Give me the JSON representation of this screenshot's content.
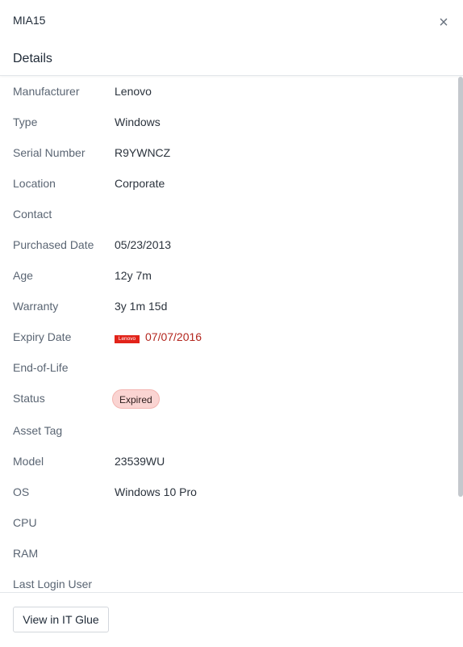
{
  "header": {
    "asset_name": "MIA15",
    "close_glyph": "×",
    "section_title": "Details"
  },
  "details": [
    {
      "label": "Manufacturer",
      "value": "Lenovo"
    },
    {
      "label": "Type",
      "value": "Windows"
    },
    {
      "label": "Serial Number",
      "value": "R9YWNCZ"
    },
    {
      "label": "Location",
      "value": "Corporate"
    },
    {
      "label": "Contact",
      "value": ""
    },
    {
      "label": "Purchased Date",
      "value": "05/23/2013"
    },
    {
      "label": "Age",
      "value": "12y 7m"
    },
    {
      "label": "Warranty",
      "value": "3y 1m 15d"
    },
    {
      "label": "Expiry Date",
      "value": "07/07/2016",
      "logo": "Lenovo"
    },
    {
      "label": "End-of-Life",
      "value": ""
    },
    {
      "label": "Status",
      "value": "Expired"
    },
    {
      "label": "Asset Tag",
      "value": ""
    },
    {
      "label": "Model",
      "value": "23539WU"
    },
    {
      "label": "OS",
      "value": "Windows 10 Pro"
    },
    {
      "label": "CPU",
      "value": ""
    },
    {
      "label": "RAM",
      "value": ""
    },
    {
      "label": "Last Login User",
      "value": ""
    }
  ],
  "footer": {
    "view_button_label": "View in IT Glue"
  },
  "colors": {
    "expired_text": "#b3261e",
    "expired_badge_bg": "#fad4d2",
    "brand_logo": "#e2231a"
  },
  "icons": {
    "close": "close-icon",
    "brand": "lenovo-logo"
  }
}
